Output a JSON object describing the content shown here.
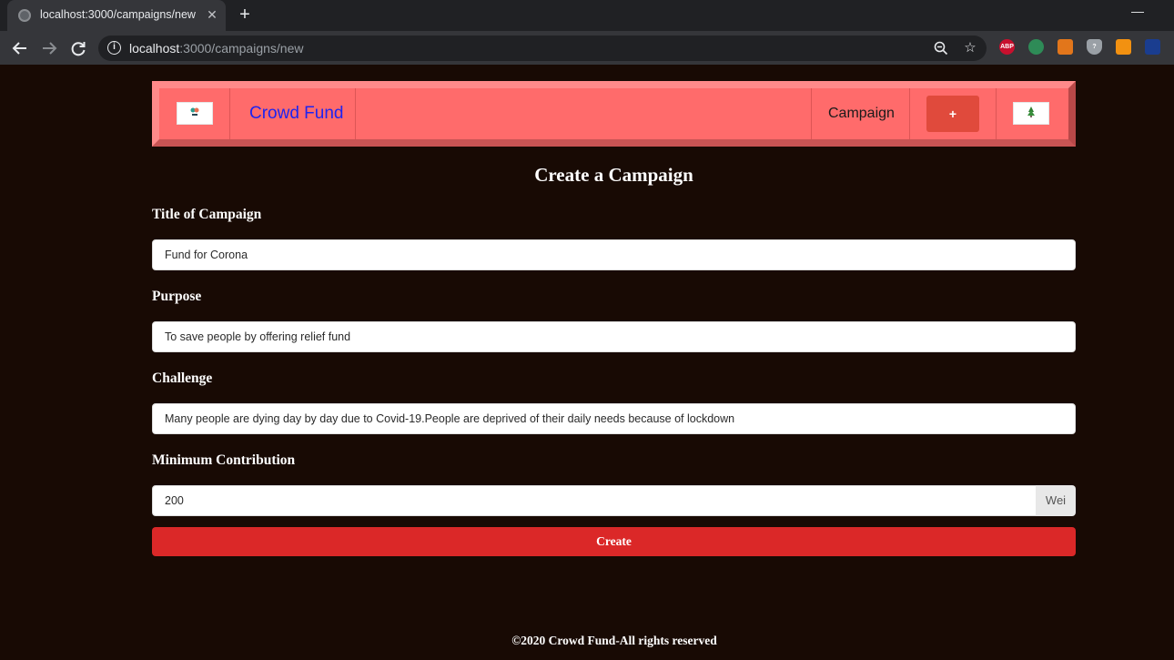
{
  "browser": {
    "tab_title": "localhost:3000/campaigns/new",
    "tab_close": "✕",
    "new_tab": "+",
    "url_host": "localhost",
    "url_path": ":3000/campaigns/new",
    "extensions": [
      "ABP",
      "",
      "",
      "?",
      "",
      ""
    ]
  },
  "navbar": {
    "brand": "Crowd Fund",
    "campaign_link": "Campaign",
    "plus_label": "+"
  },
  "page": {
    "title": "Create a Campaign"
  },
  "form": {
    "title_label": "Title of Campaign",
    "title_value": "Fund for Corona",
    "purpose_label": "Purpose",
    "purpose_value": "To save people by offering relief fund",
    "challenge_label": "Challenge",
    "challenge_value": "Many people are dying day by day due to Covid-19.People are deprived of their daily needs because of lockdown",
    "min_contribution_label": "Minimum Contribution",
    "min_contribution_value": "200",
    "unit": "Wei",
    "submit_label": "Create"
  },
  "footer": {
    "text": "©2020 Crowd Fund-All rights reserved"
  },
  "colors": {
    "page_bg": "#180a04",
    "navbar": "#ff6b6b",
    "brand_link": "#1d24f0",
    "create_button": "#db2828",
    "plus_button": "#e04a3c"
  }
}
